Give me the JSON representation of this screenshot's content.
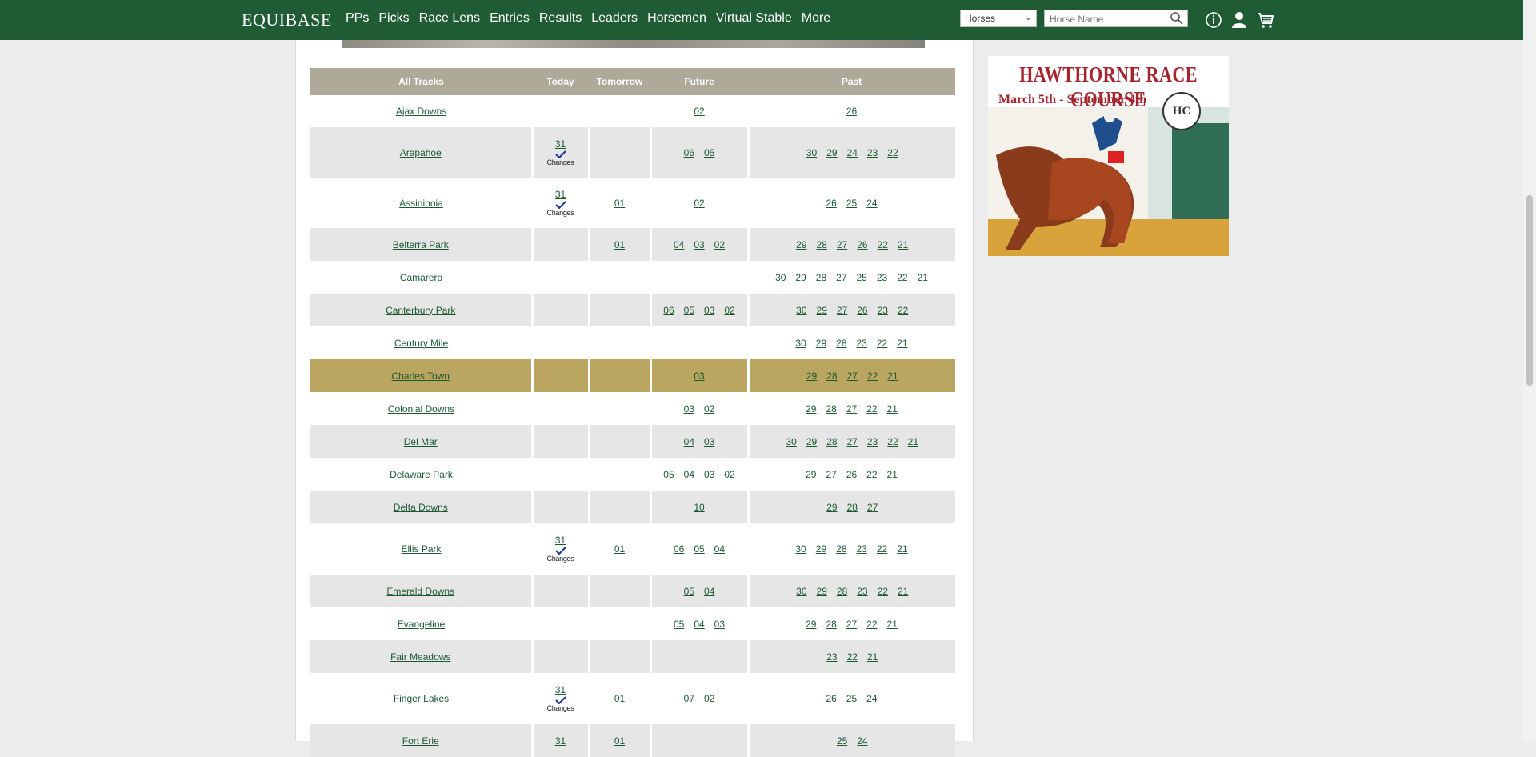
{
  "header": {
    "logo": "EQUIBASE",
    "nav": [
      "PPs",
      "Picks",
      "Race Lens",
      "Entries",
      "Results",
      "Leaders",
      "Horsemen",
      "Virtual Stable",
      "More"
    ],
    "search_type": "Horses",
    "search_placeholder": "Horse Name",
    "icons": [
      "info-icon",
      "account-icon",
      "cart-icon"
    ]
  },
  "table": {
    "headers": {
      "track": "All Tracks",
      "today": "Today",
      "tomorrow": "Tomorrow",
      "future": "Future",
      "past": "Past"
    },
    "changes_label": "Changes",
    "rows": [
      {
        "name": "Ajax Downs",
        "today": "",
        "changes": false,
        "tomorrow": "",
        "future": [
          "02"
        ],
        "past": [
          "26"
        ],
        "style": "plain"
      },
      {
        "name": "Arapahoe",
        "today": "31",
        "changes": true,
        "tomorrow": "",
        "future": [
          "06",
          "05"
        ],
        "past": [
          "30",
          "29",
          "24",
          "23",
          "22"
        ],
        "style": "shaded"
      },
      {
        "name": "Assiniboia",
        "today": "31",
        "changes": true,
        "tomorrow": "01",
        "future": [
          "02"
        ],
        "past": [
          "26",
          "25",
          "24"
        ],
        "style": "plain"
      },
      {
        "name": "Belterra Park",
        "today": "",
        "changes": false,
        "tomorrow": "01",
        "future": [
          "04",
          "03",
          "02"
        ],
        "past": [
          "29",
          "28",
          "27",
          "26",
          "22",
          "21"
        ],
        "style": "shaded"
      },
      {
        "name": "Camarero",
        "today": "",
        "changes": false,
        "tomorrow": "",
        "future": [],
        "past": [
          "30",
          "29",
          "28",
          "27",
          "25",
          "23",
          "22",
          "21"
        ],
        "style": "plain"
      },
      {
        "name": "Canterbury Park",
        "today": "",
        "changes": false,
        "tomorrow": "",
        "future": [
          "06",
          "05",
          "03",
          "02"
        ],
        "past": [
          "30",
          "29",
          "27",
          "26",
          "23",
          "22"
        ],
        "style": "shaded"
      },
      {
        "name": "Century Mile",
        "today": "",
        "changes": false,
        "tomorrow": "",
        "future": [],
        "past": [
          "30",
          "29",
          "28",
          "23",
          "22",
          "21"
        ],
        "style": "plain"
      },
      {
        "name": "Charles Town",
        "today": "",
        "changes": false,
        "tomorrow": "",
        "future": [
          "03"
        ],
        "past": [
          "29",
          "28",
          "27",
          "22",
          "21"
        ],
        "style": "hl"
      },
      {
        "name": "Colonial Downs",
        "today": "",
        "changes": false,
        "tomorrow": "",
        "future": [
          "03",
          "02"
        ],
        "past": [
          "29",
          "28",
          "27",
          "22",
          "21"
        ],
        "style": "plain"
      },
      {
        "name": "Del Mar",
        "today": "",
        "changes": false,
        "tomorrow": "",
        "future": [
          "04",
          "03"
        ],
        "past": [
          "30",
          "29",
          "28",
          "27",
          "23",
          "22",
          "21"
        ],
        "style": "shaded"
      },
      {
        "name": "Delaware Park",
        "today": "",
        "changes": false,
        "tomorrow": "",
        "future": [
          "05",
          "04",
          "03",
          "02"
        ],
        "past": [
          "29",
          "27",
          "26",
          "22",
          "21"
        ],
        "style": "plain"
      },
      {
        "name": "Delta Downs",
        "today": "",
        "changes": false,
        "tomorrow": "",
        "future": [
          "10"
        ],
        "past": [
          "29",
          "28",
          "27"
        ],
        "style": "shaded"
      },
      {
        "name": "Ellis Park",
        "today": "31",
        "changes": true,
        "tomorrow": "01",
        "future": [
          "06",
          "05",
          "04"
        ],
        "past": [
          "30",
          "29",
          "28",
          "23",
          "22",
          "21"
        ],
        "style": "plain"
      },
      {
        "name": "Emerald Downs",
        "today": "",
        "changes": false,
        "tomorrow": "",
        "future": [
          "05",
          "04"
        ],
        "past": [
          "30",
          "29",
          "28",
          "23",
          "22",
          "21"
        ],
        "style": "shaded"
      },
      {
        "name": "Evangeline",
        "today": "",
        "changes": false,
        "tomorrow": "",
        "future": [
          "05",
          "04",
          "03"
        ],
        "past": [
          "29",
          "28",
          "27",
          "22",
          "21"
        ],
        "style": "plain"
      },
      {
        "name": "Fair Meadows",
        "today": "",
        "changes": false,
        "tomorrow": "",
        "future": [],
        "past": [
          "23",
          "22",
          "21"
        ],
        "style": "shaded"
      },
      {
        "name": "Finger Lakes",
        "today": "31",
        "changes": true,
        "tomorrow": "01",
        "future": [
          "07",
          "02"
        ],
        "past": [
          "26",
          "25",
          "24"
        ],
        "style": "plain"
      },
      {
        "name": "Fort Erie",
        "today": "31",
        "changes": false,
        "tomorrow": "01",
        "future": [],
        "past": [
          "25",
          "24"
        ],
        "style": "shaded"
      }
    ]
  },
  "ad": {
    "title": "HAWTHORNE RACE COURSE",
    "subtitle": "March 5th - September 4th",
    "seal_text": "HC"
  }
}
